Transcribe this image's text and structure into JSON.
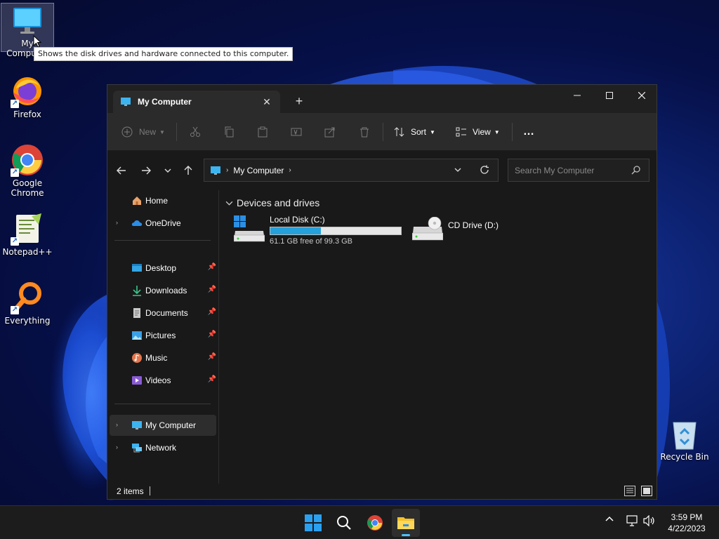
{
  "desktop": {
    "icons": [
      {
        "label": "My Computer",
        "icon": "monitor-icon"
      },
      {
        "label": "Firefox",
        "icon": "firefox-icon"
      },
      {
        "label": "Google Chrome",
        "icon": "chrome-icon"
      },
      {
        "label": "Notepad++",
        "icon": "notepad-plus-plus-icon"
      },
      {
        "label": "Everything",
        "icon": "everything-search-icon"
      }
    ],
    "tooltip": "Shows the disk drives and hardware connected to this computer.",
    "recycle_bin": "Recycle Bin"
  },
  "explorer": {
    "tab_title": "My Computer",
    "toolbar": {
      "new_label": "New",
      "sort_label": "Sort",
      "view_label": "View",
      "more_label": "…"
    },
    "address": {
      "location": "My Computer"
    },
    "search": {
      "placeholder": "Search My Computer"
    },
    "nav": {
      "home": "Home",
      "onedrive": "OneDrive",
      "quick": [
        {
          "label": "Desktop",
          "icon": "desktop-folder-icon"
        },
        {
          "label": "Downloads",
          "icon": "download-arrow-icon"
        },
        {
          "label": "Documents",
          "icon": "document-icon"
        },
        {
          "label": "Pictures",
          "icon": "pictures-icon"
        },
        {
          "label": "Music",
          "icon": "music-icon"
        },
        {
          "label": "Videos",
          "icon": "videos-icon"
        }
      ],
      "this_pc": "My Computer",
      "network": "Network"
    },
    "group_header": "Devices and drives",
    "drives": [
      {
        "name": "Local Disk (C:)",
        "free_text": "61.1 GB free of 99.3 GB",
        "used_fraction": 0.385
      },
      {
        "name": "CD Drive (D:)"
      }
    ],
    "status": {
      "items_count": "2 items"
    }
  },
  "taskbar": {
    "apps": [
      "start-icon",
      "search-icon",
      "chrome-icon",
      "file-explorer-icon"
    ],
    "time": "3:59 PM",
    "date": "4/22/2023"
  },
  "colors": {
    "accent": "#26a0da",
    "window_bg": "#191919",
    "toolbar_bg": "#2b2b2b",
    "taskbar_bg": "#1c1c1c"
  }
}
